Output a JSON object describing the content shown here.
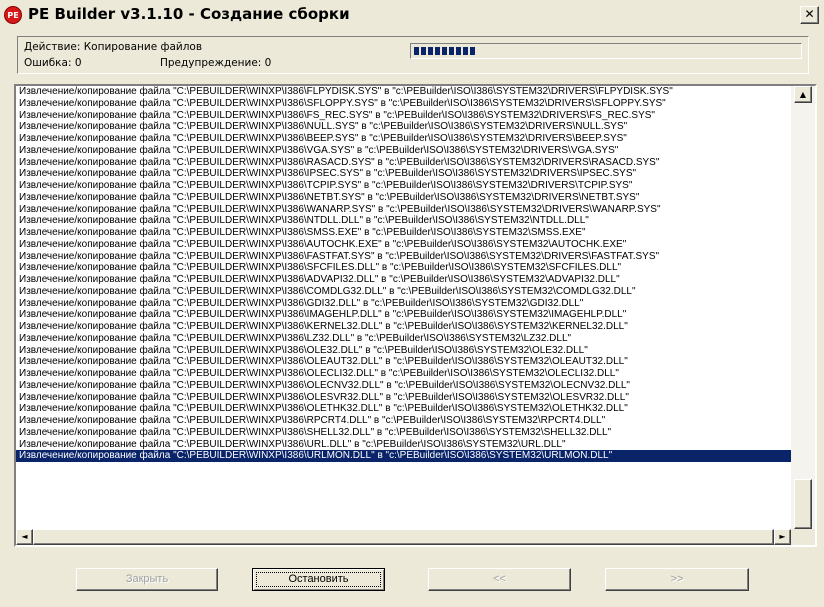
{
  "window": {
    "title": "PE Builder v3.1.10 - Создание сборки",
    "icon": "pe-builder-app-icon",
    "icon_text": "PE",
    "close_label": "✕"
  },
  "status": {
    "action_label": "Действие: Копирование файлов",
    "errors_label": "Ошибка: 0",
    "warnings_label": "Предупреждение: 0",
    "progress_fraction": 0.15,
    "progress_color": "#0a246a"
  },
  "log": {
    "lines": [
      "Извлечение/копирование файла \"C:\\PEBUILDER\\WINXP\\I386\\FLPYDISK.SYS\" в \"c:\\PEBuilder\\ISO\\I386\\SYSTEM32\\DRIVERS\\FLPYDISK.SYS\"",
      "Извлечение/копирование файла \"C:\\PEBUILDER\\WINXP\\I386\\SFLOPPY.SYS\" в \"c:\\PEBuilder\\ISO\\I386\\SYSTEM32\\DRIVERS\\SFLOPPY.SYS\"",
      "Извлечение/копирование файла \"C:\\PEBUILDER\\WINXP\\I386\\FS_REC.SYS\" в \"c:\\PEBuilder\\ISO\\I386\\SYSTEM32\\DRIVERS\\FS_REC.SYS\"",
      "Извлечение/копирование файла \"C:\\PEBUILDER\\WINXP\\I386\\NULL.SYS\" в \"c:\\PEBuilder\\ISO\\I386\\SYSTEM32\\DRIVERS\\NULL.SYS\"",
      "Извлечение/копирование файла \"C:\\PEBUILDER\\WINXP\\I386\\BEEP.SYS\" в \"c:\\PEBuilder\\ISO\\I386\\SYSTEM32\\DRIVERS\\BEEP.SYS\"",
      "Извлечение/копирование файла \"C:\\PEBUILDER\\WINXP\\I386\\VGA.SYS\" в \"c:\\PEBuilder\\ISO\\I386\\SYSTEM32\\DRIVERS\\VGA.SYS\"",
      "Извлечение/копирование файла \"C:\\PEBUILDER\\WINXP\\I386\\RASACD.SYS\" в \"c:\\PEBuilder\\ISO\\I386\\SYSTEM32\\DRIVERS\\RASACD.SYS\"",
      "Извлечение/копирование файла \"C:\\PEBUILDER\\WINXP\\I386\\IPSEC.SYS\" в \"c:\\PEBuilder\\ISO\\I386\\SYSTEM32\\DRIVERS\\IPSEC.SYS\"",
      "Извлечение/копирование файла \"C:\\PEBUILDER\\WINXP\\I386\\TCPIP.SYS\" в \"c:\\PEBuilder\\ISO\\I386\\SYSTEM32\\DRIVERS\\TCPIP.SYS\"",
      "Извлечение/копирование файла \"C:\\PEBUILDER\\WINXP\\I386\\NETBT.SYS\" в \"c:\\PEBuilder\\ISO\\I386\\SYSTEM32\\DRIVERS\\NETBT.SYS\"",
      "Извлечение/копирование файла \"C:\\PEBUILDER\\WINXP\\I386\\WANARP.SYS\" в \"c:\\PEBuilder\\ISO\\I386\\SYSTEM32\\DRIVERS\\WANARP.SYS\"",
      "Извлечение/копирование файла \"C:\\PEBUILDER\\WINXP\\I386\\NTDLL.DLL\" в \"c:\\PEBuilder\\ISO\\I386\\SYSTEM32\\NTDLL.DLL\"",
      "Извлечение/копирование файла \"C:\\PEBUILDER\\WINXP\\I386\\SMSS.EXE\" в \"c:\\PEBuilder\\ISO\\I386\\SYSTEM32\\SMSS.EXE\"",
      "Извлечение/копирование файла \"C:\\PEBUILDER\\WINXP\\I386\\AUTOCHK.EXE\" в \"c:\\PEBuilder\\ISO\\I386\\SYSTEM32\\AUTOCHK.EXE\"",
      "Извлечение/копирование файла \"C:\\PEBUILDER\\WINXP\\I386\\FASTFAT.SYS\" в \"c:\\PEBuilder\\ISO\\I386\\SYSTEM32\\DRIVERS\\FASTFAT.SYS\"",
      "Извлечение/копирование файла \"C:\\PEBUILDER\\WINXP\\I386\\SFCFILES.DLL\" в \"c:\\PEBuilder\\ISO\\I386\\SYSTEM32\\SFCFILES.DLL\"",
      "Извлечение/копирование файла \"C:\\PEBUILDER\\WINXP\\I386\\ADVAPI32.DLL\" в \"c:\\PEBuilder\\ISO\\I386\\SYSTEM32\\ADVAPI32.DLL\"",
      "Извлечение/копирование файла \"C:\\PEBUILDER\\WINXP\\I386\\COMDLG32.DLL\" в \"c:\\PEBuilder\\ISO\\I386\\SYSTEM32\\COMDLG32.DLL\"",
      "Извлечение/копирование файла \"C:\\PEBUILDER\\WINXP\\I386\\GDI32.DLL\" в \"c:\\PEBuilder\\ISO\\I386\\SYSTEM32\\GDI32.DLL\"",
      "Извлечение/копирование файла \"C:\\PEBUILDER\\WINXP\\I386\\IMAGEHLP.DLL\" в \"c:\\PEBuilder\\ISO\\I386\\SYSTEM32\\IMAGEHLP.DLL\"",
      "Извлечение/копирование файла \"C:\\PEBUILDER\\WINXP\\I386\\KERNEL32.DLL\" в \"c:\\PEBuilder\\ISO\\I386\\SYSTEM32\\KERNEL32.DLL\"",
      "Извлечение/копирование файла \"C:\\PEBUILDER\\WINXP\\I386\\LZ32.DLL\" в \"c:\\PEBuilder\\ISO\\I386\\SYSTEM32\\LZ32.DLL\"",
      "Извлечение/копирование файла \"C:\\PEBUILDER\\WINXP\\I386\\OLE32.DLL\" в \"c:\\PEBuilder\\ISO\\I386\\SYSTEM32\\OLE32.DLL\"",
      "Извлечение/копирование файла \"C:\\PEBUILDER\\WINXP\\I386\\OLEAUT32.DLL\" в \"c:\\PEBuilder\\ISO\\I386\\SYSTEM32\\OLEAUT32.DLL\"",
      "Извлечение/копирование файла \"C:\\PEBUILDER\\WINXP\\I386\\OLECLI32.DLL\" в \"c:\\PEBuilder\\ISO\\I386\\SYSTEM32\\OLECLI32.DLL\"",
      "Извлечение/копирование файла \"C:\\PEBUILDER\\WINXP\\I386\\OLECNV32.DLL\" в \"c:\\PEBuilder\\ISO\\I386\\SYSTEM32\\OLECNV32.DLL\"",
      "Извлечение/копирование файла \"C:\\PEBUILDER\\WINXP\\I386\\OLESVR32.DLL\" в \"c:\\PEBuilder\\ISO\\I386\\SYSTEM32\\OLESVR32.DLL\"",
      "Извлечение/копирование файла \"C:\\PEBUILDER\\WINXP\\I386\\OLETHK32.DLL\" в \"c:\\PEBuilder\\ISO\\I386\\SYSTEM32\\OLETHK32.DLL\"",
      "Извлечение/копирование файла \"C:\\PEBUILDER\\WINXP\\I386\\RPCRT4.DLL\" в \"c:\\PEBuilder\\ISO\\I386\\SYSTEM32\\RPCRT4.DLL\"",
      "Извлечение/копирование файла \"C:\\PEBUILDER\\WINXP\\I386\\SHELL32.DLL\" в \"c:\\PEBuilder\\ISO\\I386\\SYSTEM32\\SHELL32.DLL\"",
      "Извлечение/копирование файла \"C:\\PEBUILDER\\WINXP\\I386\\URL.DLL\" в \"c:\\PEBuilder\\ISO\\I386\\SYSTEM32\\URL.DLL\"",
      "Извлечение/копирование файла \"C:\\PEBUILDER\\WINXP\\I386\\URLMON.DLL\" в \"c:\\PEBuilder\\ISO\\I386\\SYSTEM32\\URLMON.DLL\""
    ],
    "selected_index": 31,
    "selection_color": "#0a246a",
    "scroll_up_icon": "arrow-up-icon",
    "scroll_left_icon": "arrow-left-icon",
    "scroll_right_icon": "arrow-right-icon",
    "scroll_up_glyph": "▲",
    "scroll_left_glyph": "◄",
    "scroll_right_glyph": "►"
  },
  "buttons": {
    "close_label": "Закрыть",
    "stop_label": "Остановить",
    "prev_label": "<<",
    "next_label": ">>"
  }
}
